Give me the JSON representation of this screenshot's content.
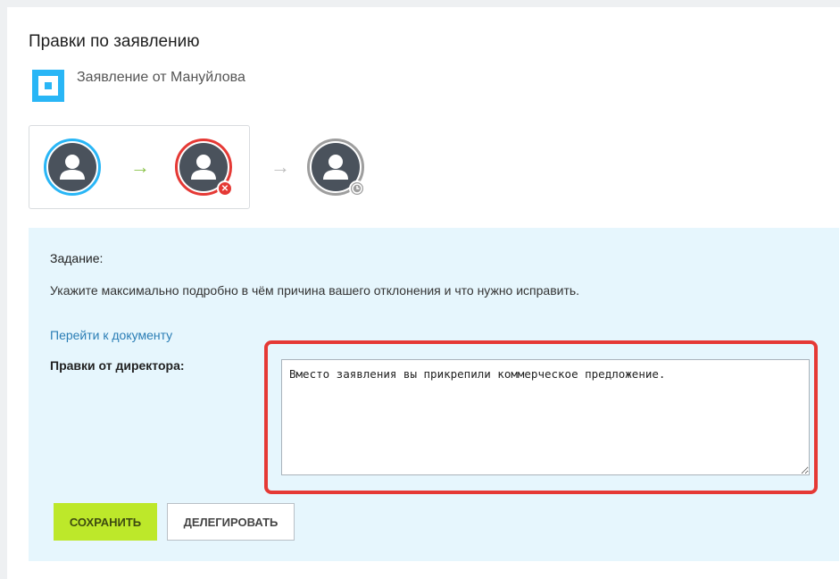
{
  "header": {
    "title": "Правки по заявлению",
    "document_title": "Заявление от Мануйлова"
  },
  "route": {
    "steps": [
      {
        "status": "approved",
        "ring_color": "#29b6f6",
        "icon": "user-avatar-icon"
      },
      {
        "status": "rejected",
        "ring_color": "#e53935",
        "badge_icon": "reject-x-icon"
      },
      {
        "status": "waiting",
        "ring_color": "#9e9e9e",
        "badge_icon": "clock-icon"
      }
    ],
    "arrow_done_color": "#8bc34a",
    "arrow_pending_color": "#bdbdbd"
  },
  "task": {
    "label": "Задание:",
    "text": "Укажите максимально подробно в чём причина вашего отклонения и что нужно исправить.",
    "doc_link": "Перейти к документу",
    "edits_label": "Правки от директора:",
    "edits_value": "Вместо заявления вы прикрепили коммерческое предложение."
  },
  "actions": {
    "save_label": "СОХРАНИТЬ",
    "delegate_label": "ДЕЛЕГИРОВАТЬ"
  },
  "colors": {
    "accent": "#29b6f6",
    "panel_bg": "#e6f6fd",
    "save_bg": "#bde82a",
    "highlight": "#e53935",
    "link": "#2a7db5"
  }
}
